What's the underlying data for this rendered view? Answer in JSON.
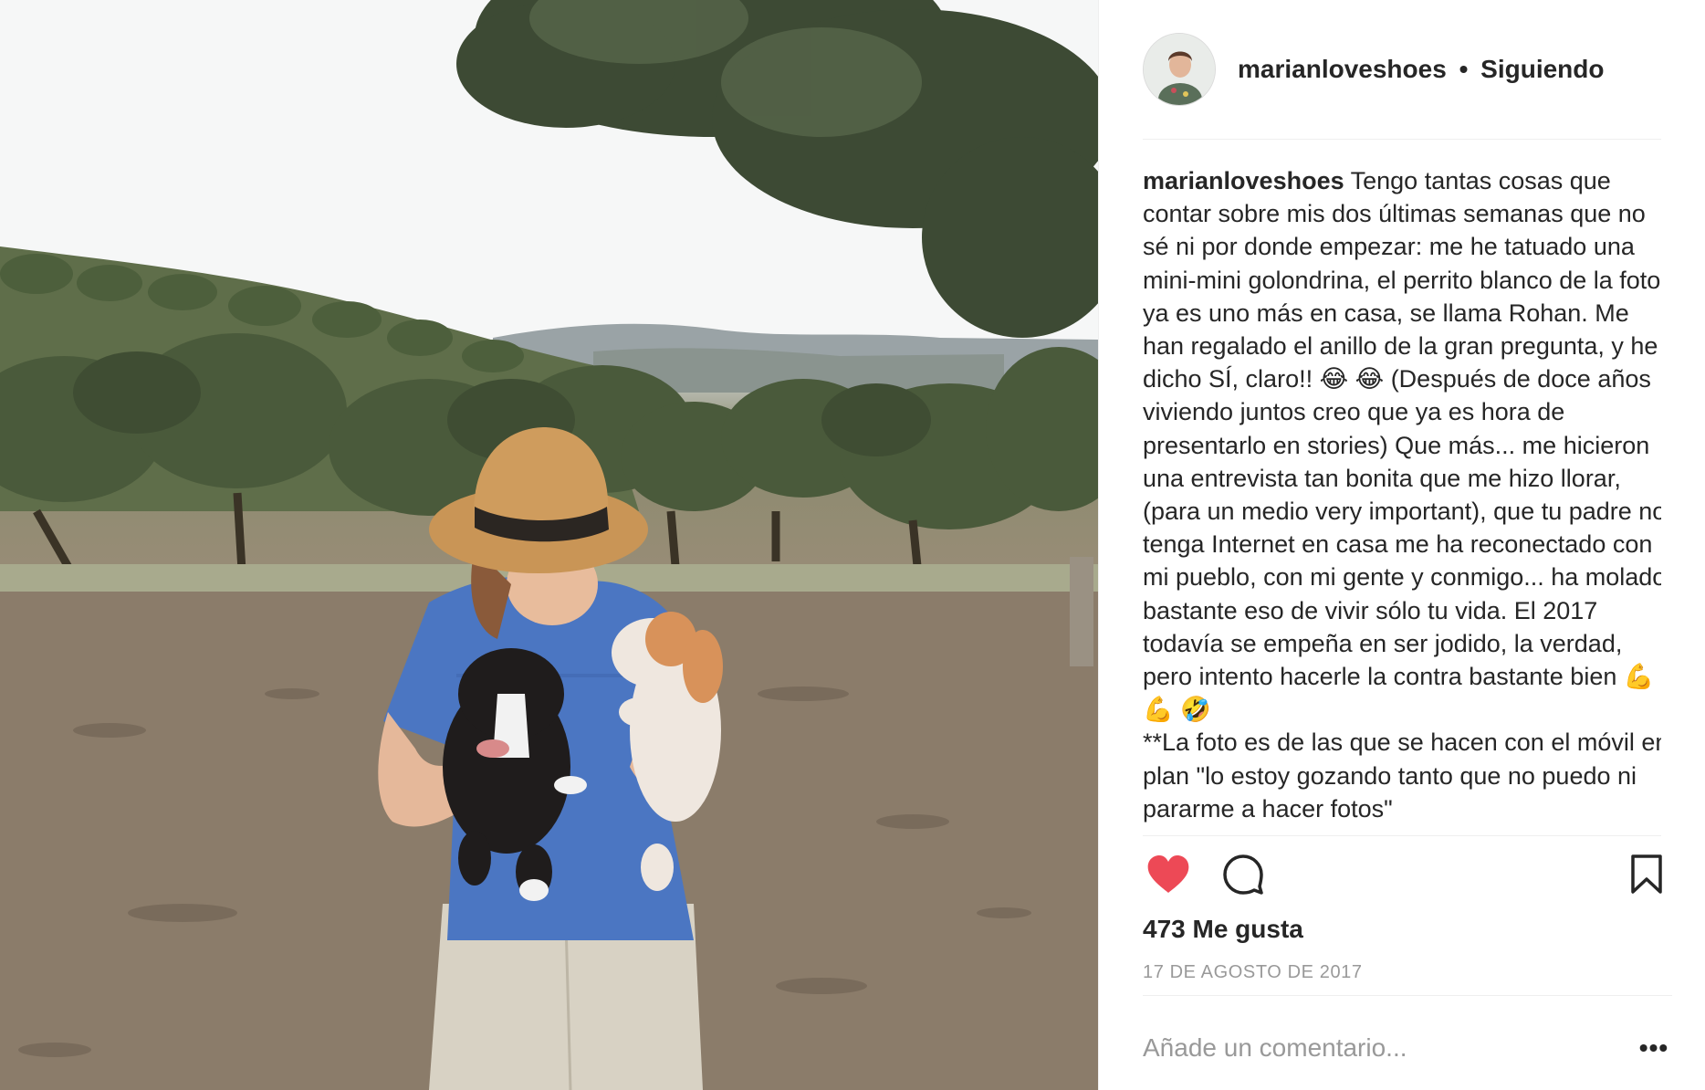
{
  "post": {
    "username": "marianloveshoes",
    "separator": "•",
    "follow_status": "Siguiendo",
    "caption_user": "marianloveshoes",
    "caption_text": " Tengo tantas cosas que contar sobre mis dos últimas semanas que no sé ni por donde empezar: me he tatuado una mini-mini golondrina, el perrito blanco de la foto ya es uno más en casa, se llama Rohan. Me han regalado el anillo de la gran pregunta, y he dicho SÍ, claro!! 😂 😂 (Después de doce años viviendo juntos creo que ya es hora de presentarlo en stories) Que más... me hicieron una entrevista tan bonita que me hizo llorar, (para un medio very important), que tu padre no tenga Internet en casa me ha reconectado con mi pueblo, con mi gente y conmigo... ha molado bastante eso de vivir sólo tu vida. El 2017 todavía se empeña en ser jodido, la verdad, pero intento hacerle la contra bastante bien 💪 💪 🤣\n**La foto es de las que se hacen con el móvil en plan \"lo estoy gozando tanto que no puedo ni pararme a hacer fotos\"",
    "likes": "473 Me gusta",
    "date": "17 DE AGOSTO DE 2017",
    "comment_placeholder": "Añade un comentario...",
    "more_label": "•••",
    "liked": true
  },
  "icons": {
    "like": "heart-icon",
    "comment": "comment-icon",
    "save": "bookmark-icon",
    "more": "more-options-icon"
  },
  "colors": {
    "heart": "#ed4956",
    "text": "#262626",
    "muted": "#999999",
    "border": "#efefef"
  }
}
